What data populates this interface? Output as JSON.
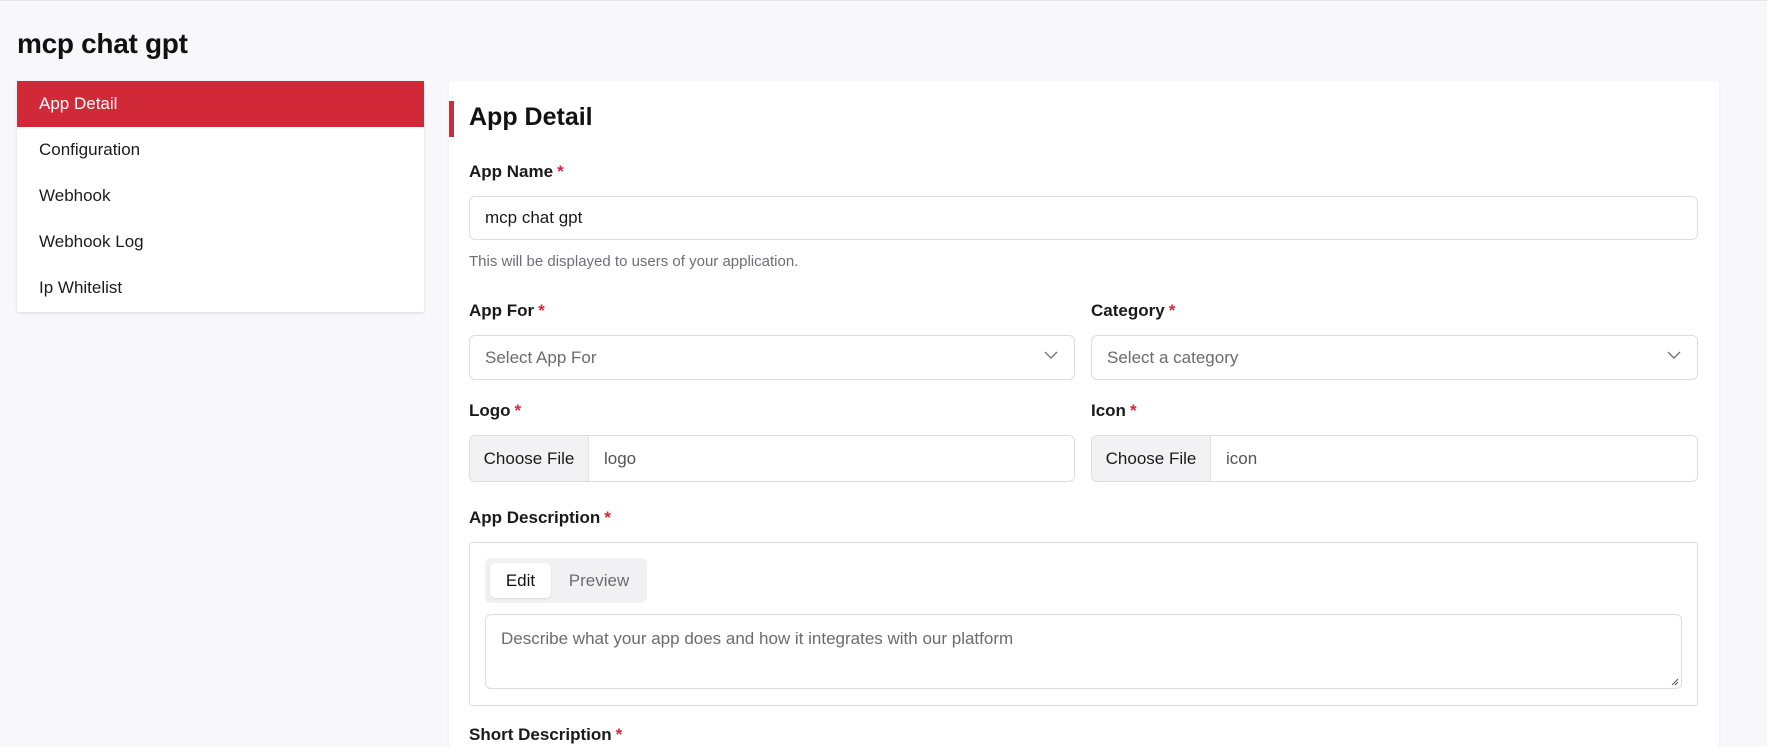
{
  "page": {
    "title": "mcp chat gpt"
  },
  "sidebar": {
    "items": [
      {
        "label": "App Detail",
        "active": true
      },
      {
        "label": "Configuration"
      },
      {
        "label": "Webhook"
      },
      {
        "label": "Webhook Log"
      },
      {
        "label": "Ip Whitelist"
      }
    ]
  },
  "form": {
    "title": "App Detail",
    "required_mark": "*",
    "app_name": {
      "label": "App Name",
      "value": "mcp chat gpt",
      "hint": "This will be displayed to users of your application."
    },
    "app_for": {
      "label": "App For",
      "placeholder": "Select App For"
    },
    "category": {
      "label": "Category",
      "placeholder": "Select a category"
    },
    "logo": {
      "label": "Logo",
      "button": "Choose File",
      "file_name": "logo"
    },
    "icon": {
      "label": "Icon",
      "button": "Choose File",
      "file_name": "icon"
    },
    "app_description": {
      "label": "App Description",
      "tabs": [
        "Edit",
        "Preview"
      ],
      "placeholder": "Describe what your app does and how it integrates with our platform"
    },
    "short_description": {
      "label": "Short Description"
    }
  },
  "colors": {
    "accent": "#d22938",
    "background": "#f8f8fc",
    "card": "#ffffff"
  }
}
